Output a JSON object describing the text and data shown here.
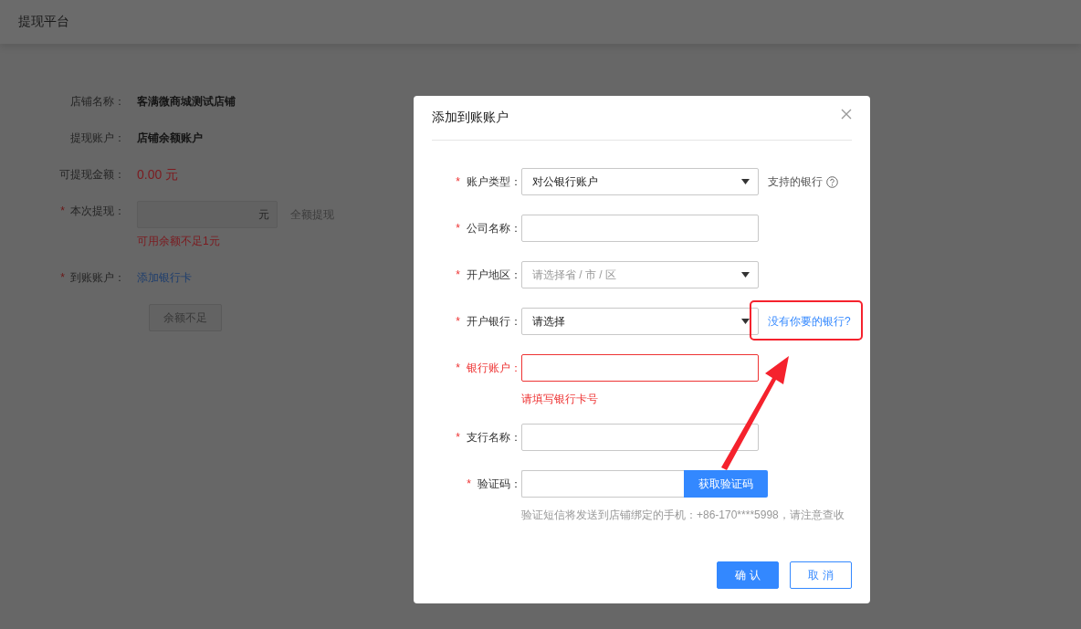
{
  "header": {
    "title": "提现平台"
  },
  "withdraw_form": {
    "rows": [
      {
        "kind": "text",
        "label": "店铺名称：",
        "value": "客满微商城测试店铺"
      },
      {
        "kind": "text",
        "label": "提现账户：",
        "value": "店铺余额账户"
      },
      {
        "kind": "amount",
        "label": "可提现金额：",
        "value": "0.00 元"
      },
      {
        "kind": "input",
        "label": "本次提现：",
        "required_mark": "*",
        "suffix": "元",
        "side_link": "全额提现",
        "disabled": true,
        "error": "可用余额不足1元"
      },
      {
        "kind": "link",
        "label": "到账账户：",
        "required_mark": "*",
        "value": "添加银行卡"
      }
    ],
    "submit": {
      "label": "余额不足",
      "disabled": true
    }
  },
  "dialog": {
    "title": "添加到账账户",
    "fields": [
      {
        "kind": "select",
        "label": "账户类型：",
        "required_mark": "*",
        "value": "对公银行账户",
        "aside": {
          "kind": "help",
          "text": "支持的银行"
        }
      },
      {
        "kind": "input",
        "label": "公司名称：",
        "required_mark": "*",
        "invalid": false
      },
      {
        "kind": "select",
        "label": "开户地区：",
        "required_mark": "*",
        "placeholder": "请选择省 / 市 / 区"
      },
      {
        "kind": "select",
        "label": "开户银行：",
        "required_mark": "*",
        "value": "请选择",
        "aside": {
          "kind": "link",
          "text": "没有你要的银行?"
        }
      },
      {
        "kind": "input",
        "label": "银行账户：",
        "required_mark": "*",
        "invalid": true,
        "error": "请填写银行卡号"
      },
      {
        "kind": "input",
        "label": "支行名称：",
        "required_mark": "*",
        "invalid": false
      },
      {
        "kind": "code",
        "label": "验证码：",
        "required_mark": "*",
        "button": "获取验证码",
        "hint": "验证短信将发送到店铺绑定的手机：+86-170****5998，请注意查收"
      }
    ],
    "buttons": [
      {
        "kind": "primary",
        "label": "确 认"
      },
      {
        "kind": "secondary",
        "label": "取 消"
      }
    ]
  }
}
